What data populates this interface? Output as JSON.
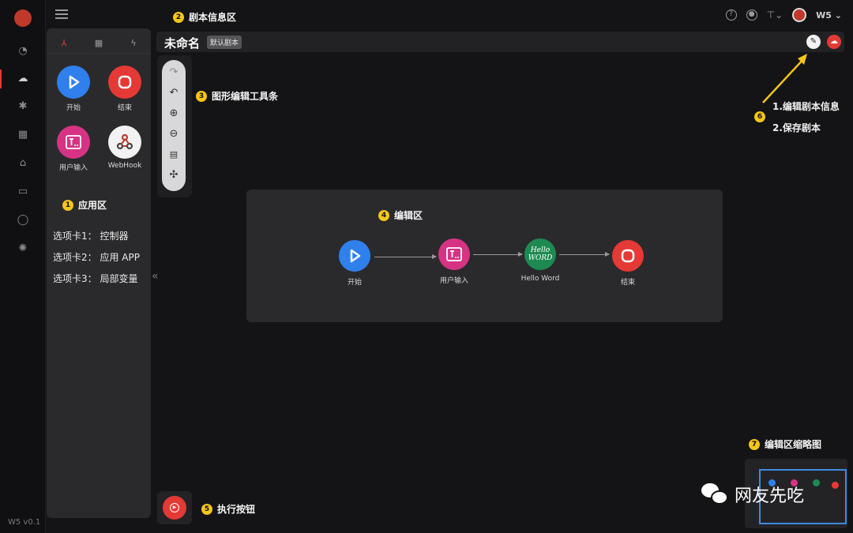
{
  "app": {
    "version": "W5 v0.1"
  },
  "topbar": {
    "user": "W5 ⌄"
  },
  "header": {
    "title": "未命名",
    "tag": "默认剧本"
  },
  "panel": {
    "apps": [
      {
        "label": "开始",
        "color": "#2f80ed"
      },
      {
        "label": "结束",
        "color": "#e53935"
      },
      {
        "label": "用户输入",
        "color": "#d63384"
      },
      {
        "label": "WebHook",
        "color": "#f2f2f2"
      }
    ],
    "legend": [
      "选项卡1： 控制器",
      "选项卡2： 应用 APP",
      "选项卡3： 局部变量"
    ]
  },
  "editor": {
    "nodes": [
      {
        "label": "开始",
        "color": "#2f80ed"
      },
      {
        "label": "用户输入",
        "color": "#d63384"
      },
      {
        "label": "Hello Word",
        "color": "#1e8a52",
        "icon_text": "Hello WORD"
      },
      {
        "label": "结束",
        "color": "#e53935"
      }
    ]
  },
  "annotations": {
    "a1": {
      "num": "1",
      "text": "应用区"
    },
    "a2": {
      "num": "2",
      "text": "剧本信息区"
    },
    "a3": {
      "num": "3",
      "text": "图形编辑工具条"
    },
    "a4": {
      "num": "4",
      "text": "编辑区"
    },
    "a5": {
      "num": "5",
      "text": "执行按钮"
    },
    "a6": {
      "num": "6",
      "line1": "1.编辑剧本信息",
      "line2": "2.保存剧本"
    },
    "a7": {
      "num": "7",
      "text": "编辑区缩略图"
    }
  },
  "watermark": {
    "text": "网友先吃"
  },
  "colors": {
    "accent": "#e53935",
    "annotation": "#f5c518",
    "minimap_frame": "#3b8be0"
  }
}
